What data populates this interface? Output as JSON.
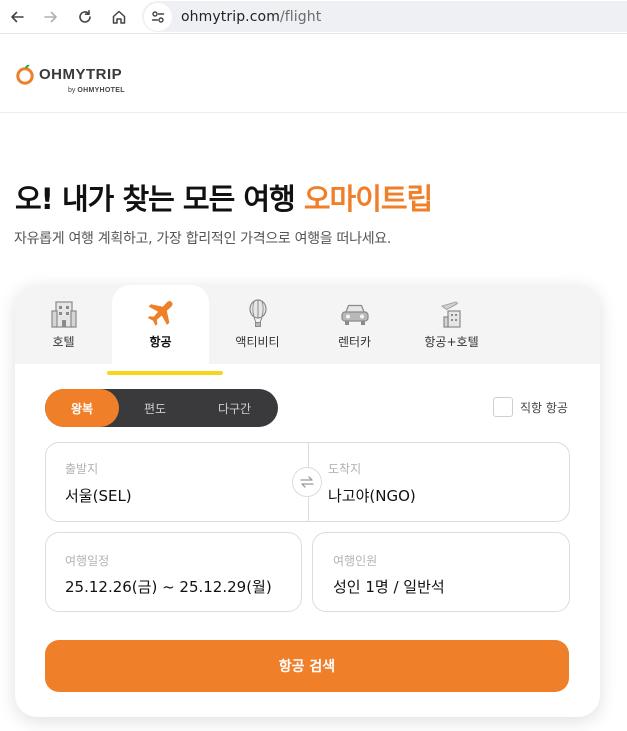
{
  "browser": {
    "url_host": "ohmytrip.com",
    "url_path": "/flight"
  },
  "header": {
    "logo_text": "OHMYTRIP",
    "logo_sub_prefix": "by ",
    "logo_sub_brand": "OHMYHOTEL",
    "accent_color": "#f07f2a"
  },
  "hero": {
    "title_main": "오! 내가 찾는 모든 여행 ",
    "title_accent": "오마이트립",
    "subtitle": "자유롭게 여행 계획하고, 가장 합리적인 가격으로 여행을 떠나세요."
  },
  "tabs": [
    {
      "label": "호텔",
      "icon": "hotel-icon",
      "active": false
    },
    {
      "label": "항공",
      "icon": "airplane-icon",
      "active": true
    },
    {
      "label": "액티비티",
      "icon": "balloon-icon",
      "active": false
    },
    {
      "label": "렌터카",
      "icon": "car-icon",
      "active": false
    },
    {
      "label": "항공+호텔",
      "icon": "flight-hotel-icon",
      "active": false
    }
  ],
  "trip_type": {
    "options": [
      "왕복",
      "편도",
      "다구간"
    ],
    "selected": "왕복"
  },
  "direct_flight": {
    "label": "직항 항공",
    "checked": false
  },
  "route": {
    "origin_label": "출발지",
    "origin_value": "서울(SEL)",
    "destination_label": "도착지",
    "destination_value": "나고야(NGO)"
  },
  "dates": {
    "label": "여행일정",
    "value": "25.12.26(금) ~ 25.12.29(월)"
  },
  "passengers": {
    "label": "여행인원",
    "value": "성인 1명 / 일반석"
  },
  "search_button": {
    "label": "항공 검색"
  }
}
